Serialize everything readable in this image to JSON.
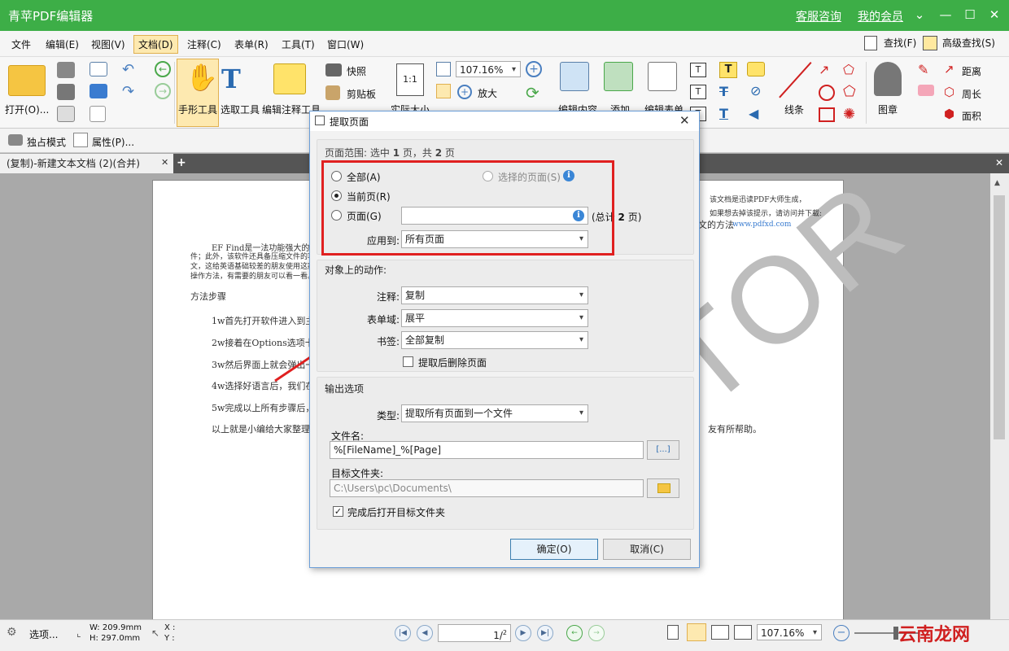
{
  "app": {
    "title": "青苹PDF编辑器",
    "service_link": "客服咨询",
    "member_link": "我的会员"
  },
  "menu": [
    "文件",
    "编辑(E)",
    "视图(V)",
    "文档(D)",
    "注释(C)",
    "表单(R)",
    "工具(T)",
    "窗口(W)"
  ],
  "find": {
    "find": "查找(F)",
    "advanced_find": "高级查找(S)"
  },
  "ribbon": {
    "open": "打开(O)...",
    "hand_tool": "手形工具",
    "select_tool": "选取工具",
    "edit_annot_tool": "编辑注释工具",
    "snapshot": "快照",
    "clipboard": "剪贴板",
    "actual_size": "实际大小",
    "zoom_value": "107.16%",
    "zoom_in": "放大",
    "edit_content": "编辑内容",
    "add": "添加",
    "edit_form": "编辑表单",
    "line": "线条",
    "stamp": "图章",
    "distance": "距离",
    "perimeter": "周长",
    "area": "面积"
  },
  "ribbon2": {
    "exclusive_mode": "独占模式",
    "properties": "属性(P)..."
  },
  "tab": {
    "name": "(复制)-新建文本文档 (2)(合并)"
  },
  "document": {
    "notice1": "该文档是迅读PDF大师生成，",
    "notice2": "如果想去掉该提示，请访问并下载:",
    "notice_url": "www.pdfxd.com",
    "notice_suffix": "文的方法",
    "para1_l1": "EF Find是一法功能强大的",
    "para1_l2": "件；此外，该软件还具备压缩文件的功",
    "para1_l3": "文，这给英语基础较差的朋友使用这款",
    "para1_l4": "操作方法，有需要的朋友可以看一看。",
    "heading": "方法步骤",
    "step1": "1w首先打开软件进入到主",
    "step2": "2w接着在Options选项卡",
    "step3": "3w然后界面上就会弹出一",
    "step4": "4w选择好语言后，我们在",
    "step5": "5w完成以上所有步骤后，",
    "summary": "以上就是小编给大家整理",
    "summary_end": "友有所帮助。",
    "watermark": "EDITOR"
  },
  "dialog": {
    "title": "提取页面",
    "range_header": "页面范围: 选中",
    "range_selected": "1",
    "range_mid": "页，共",
    "range_total": "2",
    "range_unit": "页",
    "all": "全部(A)",
    "selected_pages": "选择的页面(S)",
    "current_page": "当前页(R)",
    "pages": "页面(G)",
    "pages_total_prefix": "(总计",
    "pages_total_num": "2",
    "pages_total_suffix": "页)",
    "apply_to_label": "应用到:",
    "apply_to_value": "所有页面",
    "actions_header": "对象上的动作:",
    "annot_label": "注释:",
    "annot_value": "复制",
    "form_label": "表单域:",
    "form_value": "展平",
    "bookmark_label": "书签:",
    "bookmark_value": "全部复制",
    "delete_after": "提取后删除页面",
    "output_header": "输出选项",
    "type_label": "类型:",
    "type_value": "提取所有页面到一个文件",
    "filename_label": "文件名:",
    "filename_value": "%[FileName]_%[Page]",
    "macro_btn": "[...]",
    "folder_label": "目标文件夹:",
    "folder_value": "C:\\Users\\pc\\Documents\\",
    "open_after": "完成后打开目标文件夹",
    "ok": "确定(O)",
    "cancel": "取消(C)"
  },
  "status": {
    "options": "选项...",
    "width": "W: 209.9mm",
    "height": "H: 297.0mm",
    "x": "X :",
    "y": "Y :",
    "page_value": "1",
    "page_total": "2",
    "zoom": "107.16%"
  },
  "brand": {
    "logo": "云南龙网"
  },
  "colors": {
    "title_green": "#3dae47",
    "highlight_red": "#e02020",
    "dialog_border": "#6b9ed8"
  }
}
